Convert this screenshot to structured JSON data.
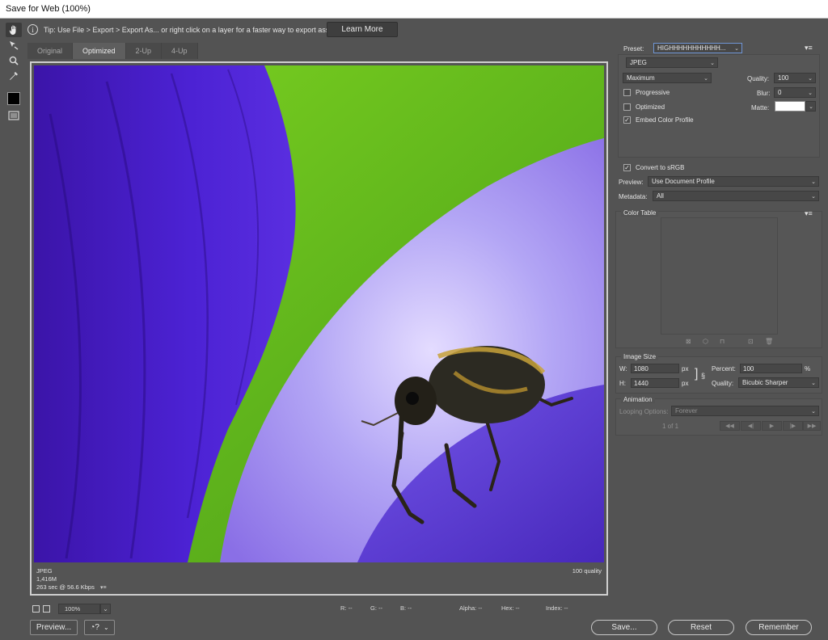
{
  "window": {
    "title": "Save for Web (100%)"
  },
  "tip": {
    "text": "Tip: Use File > Export > Export As...  or right click on a layer for a faster way to export assets",
    "learn_more": "Learn More"
  },
  "tabs": [
    {
      "label": "Original"
    },
    {
      "label": "Optimized"
    },
    {
      "label": "2-Up"
    },
    {
      "label": "4-Up"
    }
  ],
  "active_tab": "Optimized",
  "image_status": {
    "format": "JPEG",
    "size": "1,416M",
    "download": "263 sec @ 56.6 Kbps",
    "quality": "100 quality"
  },
  "bottom": {
    "zoom": "100%",
    "r": "R: --",
    "g": "G: --",
    "b": "B: --",
    "alpha": "Alpha: --",
    "hex": "Hex: --",
    "index": "Index: --"
  },
  "footer": {
    "preview": "Preview...",
    "save": "Save...",
    "reset": "Reset",
    "remember": "Remember"
  },
  "settings": {
    "preset_label": "Preset:",
    "preset_value": "HIGHHHHHHHHHHH...",
    "format": "JPEG",
    "quality_preset": "Maximum",
    "quality_label": "Quality:",
    "quality_value": "100",
    "blur_label": "Blur:",
    "blur_value": "0",
    "matte_label": "Matte:",
    "progressive": "Progressive",
    "optimized": "Optimized",
    "embed_profile": "Embed Color Profile",
    "convert_srgb": "Convert to sRGB",
    "preview_label": "Preview:",
    "preview_value": "Use Document Profile",
    "metadata_label": "Metadata:",
    "metadata_value": "All",
    "checks": {
      "progressive": false,
      "optimized": false,
      "embed_profile": true,
      "convert_srgb": true
    }
  },
  "color_table": {
    "title": "Color Table"
  },
  "image_size": {
    "title": "Image Size",
    "w_label": "W:",
    "w_value": "1080",
    "h_label": "H:",
    "h_value": "1440",
    "unit": "px",
    "percent_label": "Percent:",
    "percent_value": "100",
    "percent_unit": "%",
    "quality_label": "Quality:",
    "quality_value": "Bicubic Sharper"
  },
  "animation": {
    "title": "Animation",
    "looping_label": "Looping Options:",
    "looping_value": "Forever",
    "frame": "1 of 1"
  },
  "colors": {
    "panel_bg": "#535353",
    "accent_focus": "#6f95d4",
    "petal_blue": "#4a1fd0",
    "leaf_green": "#6ec21a",
    "petal_lavender": "#a89af0"
  }
}
